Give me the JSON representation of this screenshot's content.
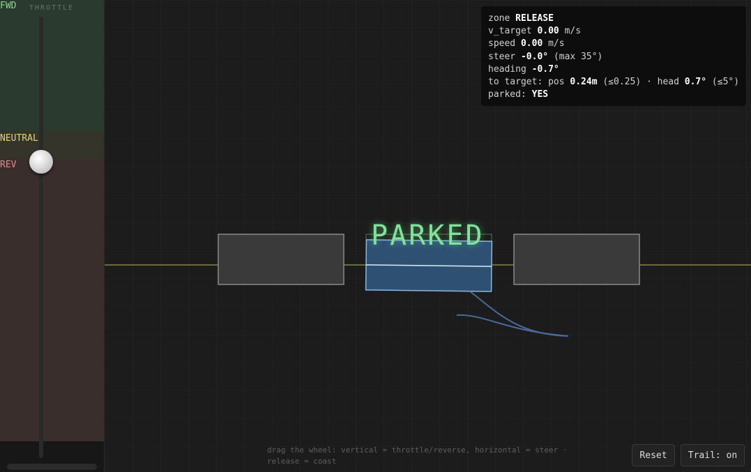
{
  "throttle": {
    "title": "THROTTLE",
    "zones": {
      "fwd": "FWD",
      "neutral": "NEUTRAL",
      "rev": "REV"
    },
    "knob_value": 0.0
  },
  "scene": {
    "status_label": "PARKED",
    "colors": {
      "parked_text": "#7fe39a",
      "car": "#2e5073",
      "car_outline": "#8ab8e0",
      "curb_line": "#6b6a3a",
      "parked_cars": "#3a3a3a",
      "trail": "#4a6a9a"
    }
  },
  "hud": {
    "zone_label": "zone",
    "zone_value": "RELEASE",
    "v_target_label": "v_target",
    "v_target_value": "0.00",
    "v_target_unit": "m/s",
    "speed_label": "speed",
    "speed_value": "0.00",
    "speed_unit": "m/s",
    "steer_label": "steer",
    "steer_value": "-0.0°",
    "steer_max": "(max 35°)",
    "heading_label": "heading",
    "heading_value": "-0.7°",
    "target_label": "to target: pos",
    "target_pos_value": "0.24m",
    "target_pos_tol": "(≤0.25) · head",
    "target_head_value": "0.7°",
    "target_head_tol": "(≤5°)",
    "parked_label": "parked:",
    "parked_value": "YES"
  },
  "footer": {
    "hint": "drag the wheel: vertical = throttle/reverse, horizontal = steer · release = coast",
    "reset_label": "Reset",
    "trail_label": "Trail: on"
  }
}
